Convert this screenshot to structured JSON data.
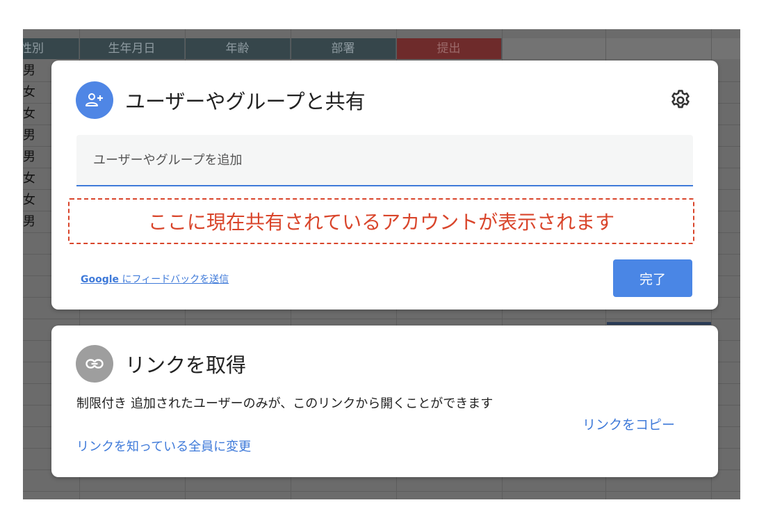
{
  "spreadsheet": {
    "headers": [
      {
        "label": "性別"
      },
      {
        "label": "生年月日"
      },
      {
        "label": "年齢"
      },
      {
        "label": "部署"
      },
      {
        "label": "提出"
      }
    ],
    "gender_values": [
      "男",
      "女",
      "女",
      "男",
      "男",
      "女",
      "女",
      "男"
    ]
  },
  "share_dialog": {
    "title": "ユーザーやグループと共有",
    "add_input_placeholder": "ユーザーやグループを追加",
    "current_accounts_note": "ここに現在共有されているアカウントが表示されます",
    "feedback_google": "Google",
    "feedback_text": " にフィードバックを送信",
    "done_label": "完了"
  },
  "link_dialog": {
    "title": "リンクを取得",
    "restriction_label": "制限付き",
    "restriction_description": "追加されたユーザーのみが、このリンクから開くことができます",
    "change_access_label": "リンクを知っている全員に変更",
    "copy_link_label": "リンクをコピー"
  },
  "colors": {
    "accent": "#4a86e5",
    "note_red": "#d9452b",
    "link_icon_gray": "#9e9e9e"
  },
  "icons": {
    "add_user": "person-add-icon",
    "settings": "gear-icon",
    "link": "link-icon"
  }
}
